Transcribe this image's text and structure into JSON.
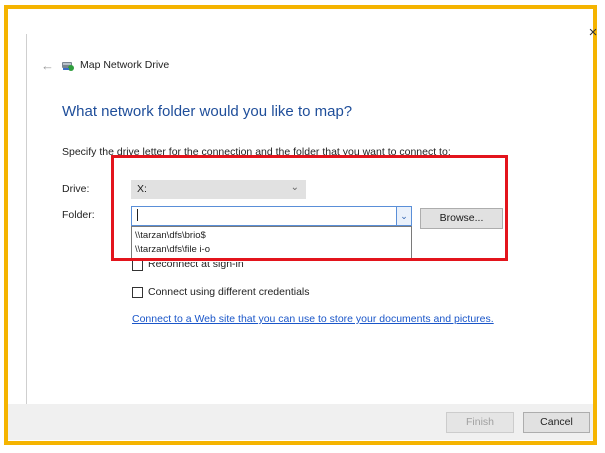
{
  "dialog": {
    "close_glyph": "×",
    "back_glyph": "←",
    "title": "Map Network Drive",
    "heading": "What network folder would you like to map?",
    "description": "Specify the drive letter for the connection and the folder that you want to connect to:",
    "icons": {
      "back": "back-arrow-icon",
      "app": "network-drive-icon",
      "close": "close-icon"
    }
  },
  "form": {
    "drive_label": "Drive:",
    "drive_value": "X:",
    "folder_label": "Folder:",
    "folder_value": "",
    "browse_label": "Browse...",
    "folder_suggestions": [
      "\\\\tarzan\\dfs\\brio$",
      "\\\\tarzan\\dfs\\file i-o"
    ],
    "reconnect_label": "Reconnect at sign-in",
    "reconnect_checked": false,
    "credentials_label": "Connect using different credentials",
    "credentials_checked": false,
    "link_text": "Connect to a Web site that you can use to store your documents and pictures."
  },
  "footer": {
    "finish_label": "Finish",
    "cancel_label": "Cancel"
  },
  "colors": {
    "frame_border": "#f5b400",
    "highlight_box": "#e3141c",
    "heading": "#1f4e9a",
    "link": "#1a56c9"
  }
}
